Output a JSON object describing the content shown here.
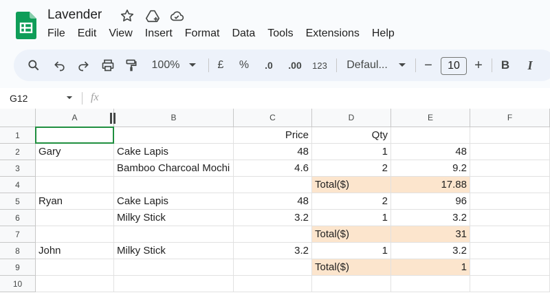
{
  "doc": {
    "title": "Lavender"
  },
  "menu": [
    "File",
    "Edit",
    "View",
    "Insert",
    "Format",
    "Data",
    "Tools",
    "Extensions",
    "Help"
  ],
  "toolbar": {
    "zoom": "100%",
    "currency": "£",
    "percent": "%",
    "dec_decrease": ".0",
    "dec_increase": ".00",
    "number_format": "123",
    "font": "Defaul...",
    "font_size": "10",
    "minus": "−",
    "plus": "+",
    "bold": "B",
    "italic": "I"
  },
  "formula_bar": {
    "name_box": "G12",
    "fx": "fx"
  },
  "columns": [
    "A",
    "B",
    "C",
    "D",
    "E",
    "F"
  ],
  "rows": [
    "1",
    "2",
    "3",
    "4",
    "5",
    "6",
    "7",
    "8",
    "9",
    "10"
  ],
  "cells": [
    [
      "",
      "",
      "Price",
      "Qty",
      "",
      ""
    ],
    [
      "Gary",
      "Cake Lapis",
      "48",
      "1",
      "48",
      ""
    ],
    [
      "",
      "Bamboo Charcoal Mochi",
      "4.6",
      "2",
      "9.2",
      ""
    ],
    [
      "",
      "",
      "",
      "Total($)",
      "17.88",
      ""
    ],
    [
      "Ryan",
      "Cake Lapis",
      "48",
      "2",
      "96",
      ""
    ],
    [
      "",
      "Milky Stick",
      "3.2",
      "1",
      "3.2",
      ""
    ],
    [
      "",
      "",
      "",
      "Total($)",
      "31",
      ""
    ],
    [
      "John",
      "Milky Stick",
      "3.2",
      "1",
      "3.2",
      ""
    ],
    [
      "",
      "",
      "",
      "Total($)",
      "1",
      ""
    ],
    [
      "",
      "",
      "",
      "",
      "",
      ""
    ]
  ],
  "colors": {
    "highlight": "#fce5cd",
    "selection": "#1e8e3e",
    "sheets_green": "#0f9d58"
  }
}
